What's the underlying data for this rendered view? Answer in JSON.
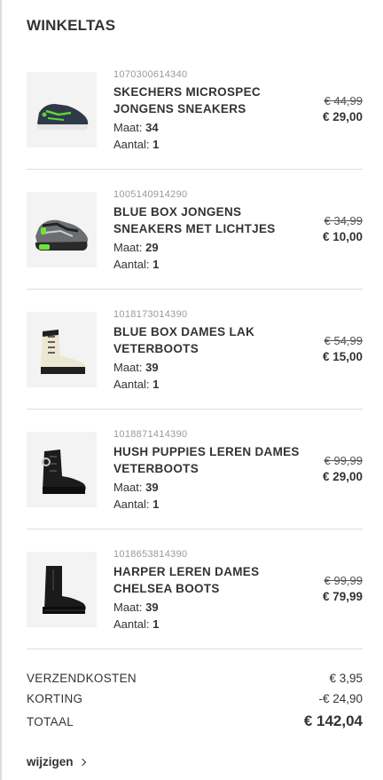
{
  "header": {
    "title": "WINKELTAS"
  },
  "labels": {
    "size": "Maat:",
    "quantity": "Aantal:"
  },
  "items": [
    {
      "sku": "1070300614340",
      "name": "SKECHERS MICROSPEC JONGENS SNEAKERS",
      "size": "34",
      "quantity": "1",
      "old_price": "€ 44,99",
      "new_price": "€ 29,00",
      "image": "shoe-sneaker-navy-green"
    },
    {
      "sku": "1005140914290",
      "name": "BLUE BOX JONGENS SNEAKERS MET LICHTJES",
      "size": "29",
      "quantity": "1",
      "old_price": "€ 34,99",
      "new_price": "€ 10,00",
      "image": "shoe-sneaker-grey-lights"
    },
    {
      "sku": "1018173014390",
      "name": "BLUE BOX DAMES LAK VETERBOOTS",
      "size": "39",
      "quantity": "1",
      "old_price": "€ 54,99",
      "new_price": "€ 15,00",
      "image": "boot-cream-lace"
    },
    {
      "sku": "1018871414390",
      "name": "HUSH PUPPIES LEREN DAMES VETERBOOTS",
      "size": "39",
      "quantity": "1",
      "old_price": "€ 99,99",
      "new_price": "€ 29,00",
      "image": "boot-black-buckle"
    },
    {
      "sku": "1018653814390",
      "name": "HARPER LEREN DAMES CHELSEA BOOTS",
      "size": "39",
      "quantity": "1",
      "old_price": "€ 99,99",
      "new_price": "€ 79,99",
      "image": "boot-black-chelsea"
    }
  ],
  "totals": {
    "shipping_label": "VERZENDKOSTEN",
    "shipping_value": "€ 3,95",
    "discount_label": "KORTING",
    "discount_value": "-€ 24,90",
    "total_label": "TOTAAL",
    "total_value": "€ 142,04"
  },
  "actions": {
    "edit_label": "wijzigen"
  }
}
